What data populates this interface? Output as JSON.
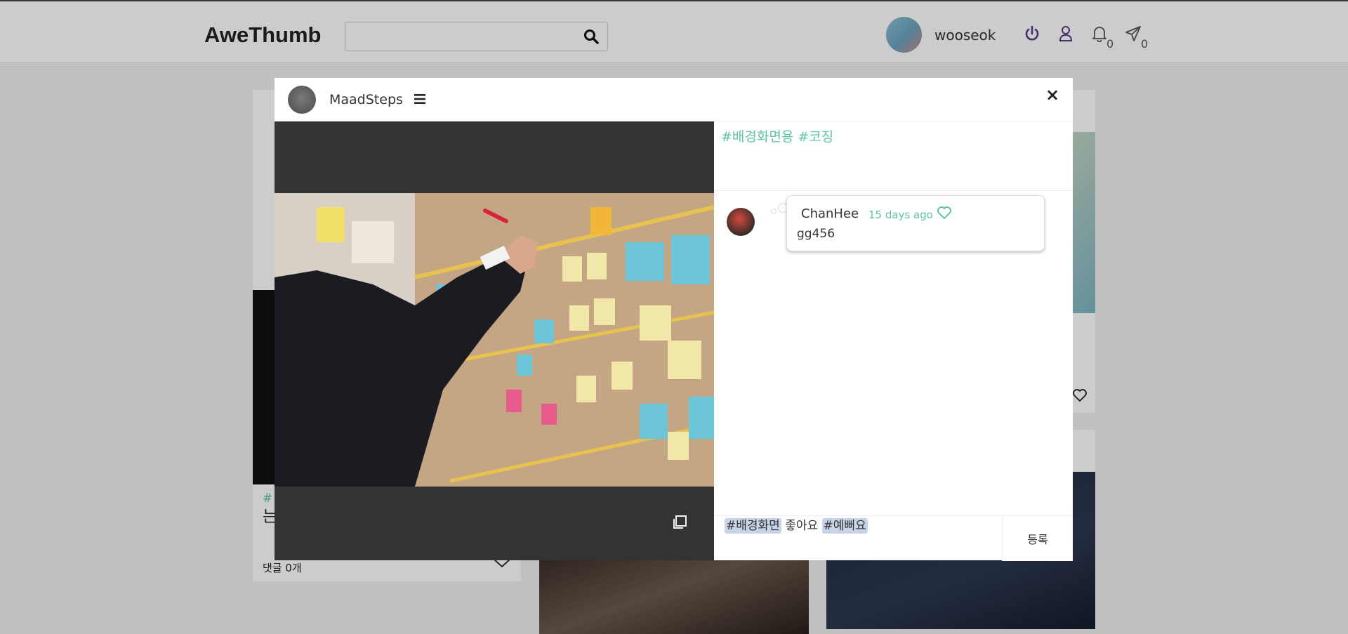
{
  "app": {
    "brand": "AweThumb"
  },
  "search": {
    "placeholder": ""
  },
  "navbar": {
    "username": "wooseok",
    "notification_count": "0",
    "message_count": "0"
  },
  "background_feed": {
    "card_hashtag_fragment": "#",
    "card_text_fragment": "는",
    "card_comment_count": "댓글 0개"
  },
  "modal": {
    "author": "MaadSteps",
    "close_label": "×",
    "hashtags": "#배경화면용 #코징",
    "comments": [
      {
        "user": "ChanHee",
        "time": "15 days ago",
        "text": "gg456"
      }
    ],
    "composer": {
      "tag1": "#배경화면",
      "middle": " 좋아요 ",
      "tag2": "#예뻐요"
    },
    "submit_label": "등록"
  },
  "colors": {
    "accent": "#5ec4a8",
    "nav_icon": "#5a3d8a",
    "tag_highlight": "#c7d4e8",
    "media_bg": "#333333"
  },
  "icons": [
    "search-icon",
    "power-icon",
    "user-icon",
    "bell-icon",
    "send-icon",
    "hamburger-icon",
    "close-icon",
    "heart-icon",
    "copy-icon"
  ]
}
